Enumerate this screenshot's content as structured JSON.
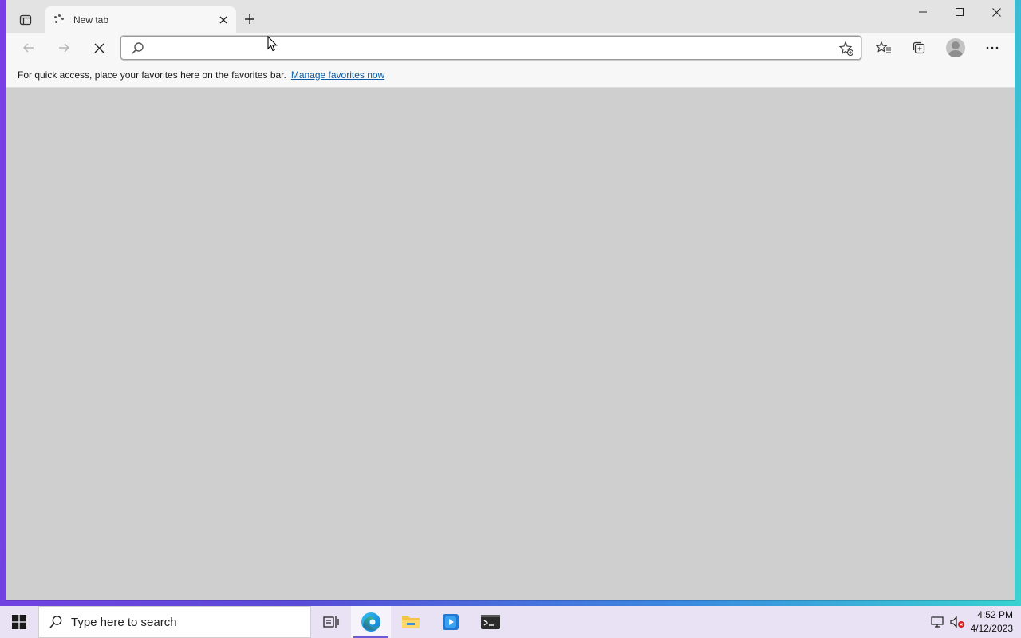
{
  "tab": {
    "title": "New tab"
  },
  "addressbar": {
    "value": "",
    "placeholder": ""
  },
  "favorites_bar": {
    "message": "For quick access, place your favorites here on the favorites bar.",
    "link": "Manage favorites now"
  },
  "taskbar": {
    "search_placeholder": "Type here to search",
    "time": "4:52 PM",
    "date": "4/12/2023"
  },
  "icons": {
    "tab_actions": "tab-actions-icon",
    "close_tab": "close-icon",
    "new_tab": "plus-icon",
    "back": "back-arrow-icon",
    "forward": "forward-arrow-icon",
    "stop": "stop-icon",
    "search": "search-icon",
    "add_favorite": "star-add-icon",
    "favorites": "favorites-icon",
    "collections": "collections-icon",
    "profile": "profile-icon",
    "more": "more-icon"
  },
  "colors": {
    "accent": "#6b5bd6",
    "link": "#0a5ba8"
  }
}
